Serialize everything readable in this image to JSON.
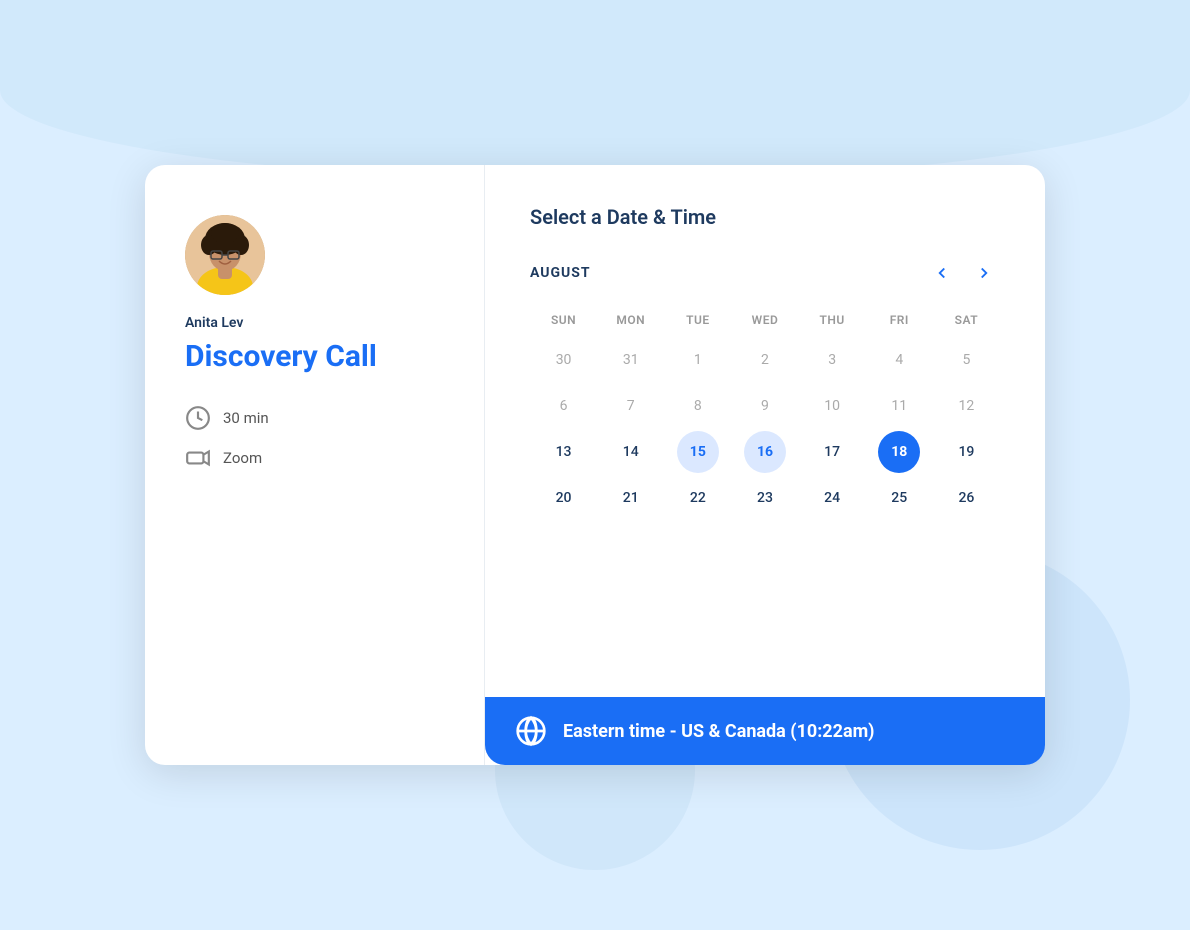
{
  "background": {
    "color": "#dbeeff"
  },
  "card": {
    "left_panel": {
      "host_name": "Anita Lev",
      "event_title": "Discovery Call",
      "duration_label": "30 min",
      "platform_label": "Zoom"
    },
    "right_panel": {
      "section_title": "Select a Date & Time",
      "calendar": {
        "month_label": "AUGUST",
        "day_headers": [
          "SUN",
          "MON",
          "TUE",
          "WED",
          "THU",
          "FRI",
          "SAT"
        ],
        "weeks": [
          [
            {
              "day": "30",
              "state": "other"
            },
            {
              "day": "31",
              "state": "other"
            },
            {
              "day": "1",
              "state": "other"
            },
            {
              "day": "2",
              "state": "other"
            },
            {
              "day": "3",
              "state": "other"
            },
            {
              "day": "4",
              "state": "other"
            },
            {
              "day": "5",
              "state": "other"
            }
          ],
          [
            {
              "day": "6",
              "state": "other"
            },
            {
              "day": "7",
              "state": "other"
            },
            {
              "day": "8",
              "state": "other"
            },
            {
              "day": "9",
              "state": "other"
            },
            {
              "day": "10",
              "state": "other"
            },
            {
              "day": "11",
              "state": "other"
            },
            {
              "day": "12",
              "state": "other"
            }
          ],
          [
            {
              "day": "13",
              "state": "available"
            },
            {
              "day": "14",
              "state": "available"
            },
            {
              "day": "15",
              "state": "highlighted"
            },
            {
              "day": "16",
              "state": "highlighted"
            },
            {
              "day": "17",
              "state": "available"
            },
            {
              "day": "18",
              "state": "selected-primary"
            },
            {
              "day": "19",
              "state": "available"
            }
          ],
          [
            {
              "day": "20",
              "state": "available"
            },
            {
              "day": "21",
              "state": "available"
            },
            {
              "day": "22",
              "state": "available"
            },
            {
              "day": "23",
              "state": "available"
            },
            {
              "day": "24",
              "state": "available"
            },
            {
              "day": "25",
              "state": "available"
            },
            {
              "day": "26",
              "state": "available"
            }
          ]
        ]
      },
      "timezone_bar": {
        "timezone_text": "Eastern time - US & Canada (10:22am)"
      }
    }
  },
  "nav": {
    "prev_label": "‹",
    "next_label": "›"
  }
}
